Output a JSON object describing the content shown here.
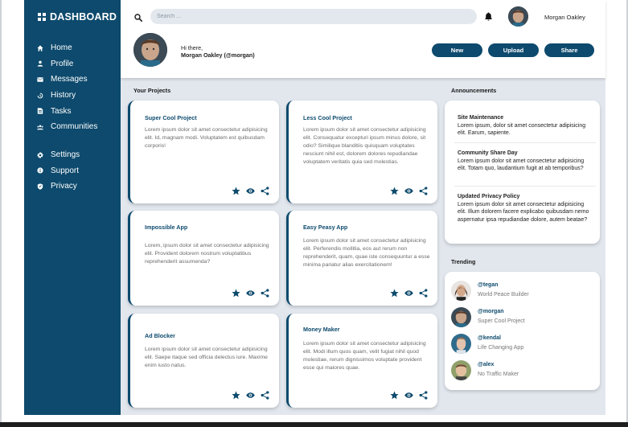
{
  "sidebar": {
    "brand": "DASHBOARD",
    "primary": [
      {
        "label": "Home",
        "icon": "home-icon"
      },
      {
        "label": "Profile",
        "icon": "profile-icon"
      },
      {
        "label": "Messages",
        "icon": "mail-icon"
      },
      {
        "label": "History",
        "icon": "history-icon"
      },
      {
        "label": "Tasks",
        "icon": "tasks-icon"
      },
      {
        "label": "Communities",
        "icon": "communities-icon"
      }
    ],
    "secondary": [
      {
        "label": "Settings",
        "icon": "gear-icon"
      },
      {
        "label": "Support",
        "icon": "support-icon"
      },
      {
        "label": "Privacy",
        "icon": "shield-icon"
      }
    ]
  },
  "header": {
    "search_placeholder": "Search ...",
    "username": "Morgan Oakley",
    "greeting": "Hi there,",
    "greeting_name": "Morgan Oakley (@morgan)",
    "buttons": {
      "new": "New",
      "upload": "Upload",
      "share": "Share"
    }
  },
  "projects": {
    "title": "Your Projects",
    "items": [
      {
        "title": "Super Cool Project",
        "text": "Lorem ipsum dolor sit amet consectetur adipisicing elit. Id, magnam modi. Voluptatem est quibusdam corporis!"
      },
      {
        "title": "Less Cool Project",
        "text": "Lorem ipsum dolor sit amet consectetur adipisicing elit. Consequatur excepturi ipsum minus dolore, sit odio? Similique blanditiis quisquam voluptates nesciunt nihil est, dolorem dolores repudiandae voluptatem veritatis quia sed molestias."
      },
      {
        "title": "Impossible App",
        "text": "Lorem, ipsum dolor sit amet consectetur adipisicing elit. Provident dolorem nostrum voluptatibus reprehenderit assumenda?"
      },
      {
        "title": "Easy Peasy App",
        "text": "Lorem ipsum dolor sit amet consectetur adipisicing elit. Perferendis mollitia, eos aut rerum non reprehenderit, quam, quae iste consequuntur a esse minima pariatur alias exercitationem!"
      },
      {
        "title": "Ad Blocker",
        "text": "Lorem ipsum dolor sit amet consectetur adipisicing elit. Saepe itaque sed officia delectus iure. Maxime enim iusto natus."
      },
      {
        "title": "Money Maker",
        "text": "Lorem ipsum dolor sit amet consectetur adipisicing elit. Modi illum quos quam, velit fugiat nihil quod molestiae, rerum dignissimos voluptate provident esse qui maiores quae."
      }
    ]
  },
  "announcements": {
    "title": "Announcements",
    "items": [
      {
        "title": "Site Maintenance",
        "text": "Lorem ipsum, dolor sit amet consectetur adipisicing elit. Earum, sapiente."
      },
      {
        "title": "Community Share Day",
        "text": "Lorem ipsum dolor sit amet consectetur adipisicing elit. Totam quo, laudantium fugit at ab temporibus?"
      },
      {
        "title": "Updated Privacy Policy",
        "text": "Lorem ipsum dolor sit amet consectetur adipisicing elit. Illum dolorem facere explicabo quibusdam nemo aspernatur ipsa repudiandae dolore, autem beatae?"
      }
    ]
  },
  "trending": {
    "title": "Trending",
    "items": [
      {
        "handle": "@tegan",
        "desc": "World Peace Builder"
      },
      {
        "handle": "@morgan",
        "desc": "Super Cool Project"
      },
      {
        "handle": "@kendal",
        "desc": "Life Changing App"
      },
      {
        "handle": "@alex",
        "desc": "No Traffic Maker"
      }
    ]
  },
  "colors": {
    "primary": "#0d4a6d",
    "background": "#e2e7ee"
  }
}
